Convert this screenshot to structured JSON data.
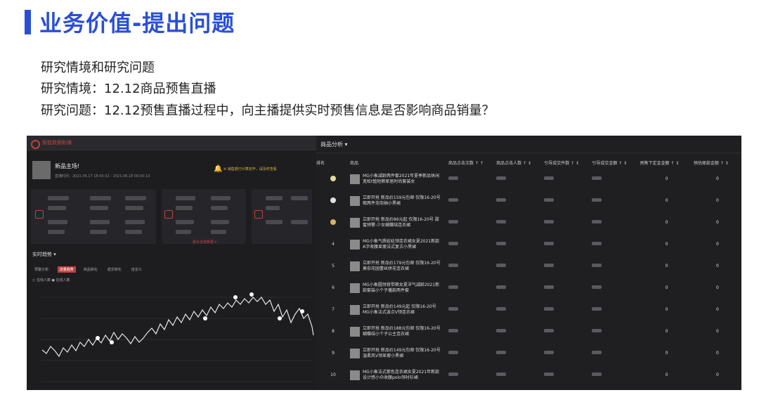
{
  "slide": {
    "title": "业务价值-提出问题",
    "line1": "研究情境和研究问题",
    "line2": "研究情境：12.12商品预售直播",
    "line3": "研究问题：12.12预售直播过程中，向主播提供实时预售信息是否影响商品销量？"
  },
  "dashboard": {
    "app_name": "智能数据助播",
    "host_title": "新品主场!",
    "host_meta": "直播时间：2021.06.17 18:00:32 - 2021.06.18 00:00:13",
    "notice": "※ 销售额已计算完毕，请及时查看",
    "more_link": "展示全部数据 ▾",
    "trend_title": "实时趋势 ▾",
    "tabs": [
      "预警分析:",
      "流量趋势",
      "商品转化",
      "成交转化",
      "自定义"
    ],
    "legend": "○ 在线人数  ● 在线人数"
  },
  "table": {
    "title": "商品分析 ▾",
    "headers": [
      "排名",
      "商品",
      "商品点击次数 ↑ ↑",
      "商品点击人数 ↑ ↕",
      "引导成交件数 ↑ ↕",
      "引导成交金额 ↑ ↕",
      "预售下定金金额 ↑ ↕",
      "预估尾款金额 ↑ ↕"
    ],
    "rows": [
      {
        "rank": "",
        "name": "MG小象减龄两件套2021年夏季新品休闲宽松t恤短裤家居时尚套装女",
        "v1": "0",
        "v2": "0"
      },
      {
        "rank": "",
        "name": "立即开抢 新品价159元包邮 仅限16-20号 假两件泡泡袖小黑裙",
        "v1": "0",
        "v2": "0"
      },
      {
        "rank": "",
        "name": "立即开抢 新品价86元起 仅限16-20号 甜蜜预警-少女蝴蝶结连衣裙",
        "v1": "0",
        "v2": "0"
      },
      {
        "rank": "4",
        "name": "MG小象气质娃娃领连衣裙女夏2021新款A字收腰显瘦法式复古小黑裙",
        "v1": "0",
        "v2": "0"
      },
      {
        "rank": "5",
        "name": "立即开抢 新品价179元包邮 仅限16-20号 莫奈花园蕾丝拼花连衣裙",
        "v1": "0",
        "v2": "0"
      },
      {
        "rank": "6",
        "name": "MG小象圆领背带裤女夏洋气减龄2021新款套装小个子播款两件套",
        "v1": "0",
        "v2": "0"
      },
      {
        "rank": "7",
        "name": "立即开抢 新品价149元起 仅限16-20号 MG小象法式波点V领连衣裙",
        "v1": "0",
        "v2": "0"
      },
      {
        "rank": "8",
        "name": "立即开抢 新品价188元包邮 仅限16-20号 蝴蝶结小个子公主连衣裙",
        "v1": "0",
        "v2": "0"
      },
      {
        "rank": "9",
        "name": "立即开抢 新品价149元包邮 仅限16-20号 温柔风V领显瘦小黑裙",
        "v1": "0",
        "v2": "0"
      },
      {
        "rank": "10",
        "name": "MG小象法式紫色连衣裙女夏2021年新款设计感小众收腰polo领衬衫裙",
        "v1": "0",
        "v2": "0"
      }
    ]
  },
  "colors": {
    "accent": "#2a4fd6",
    "dash_bg": "#1d1d20",
    "table_bg": "#1f1f22",
    "alert": "#c04040"
  },
  "icons": [
    "bell-icon",
    "logo-icon",
    "medal-icon"
  ]
}
